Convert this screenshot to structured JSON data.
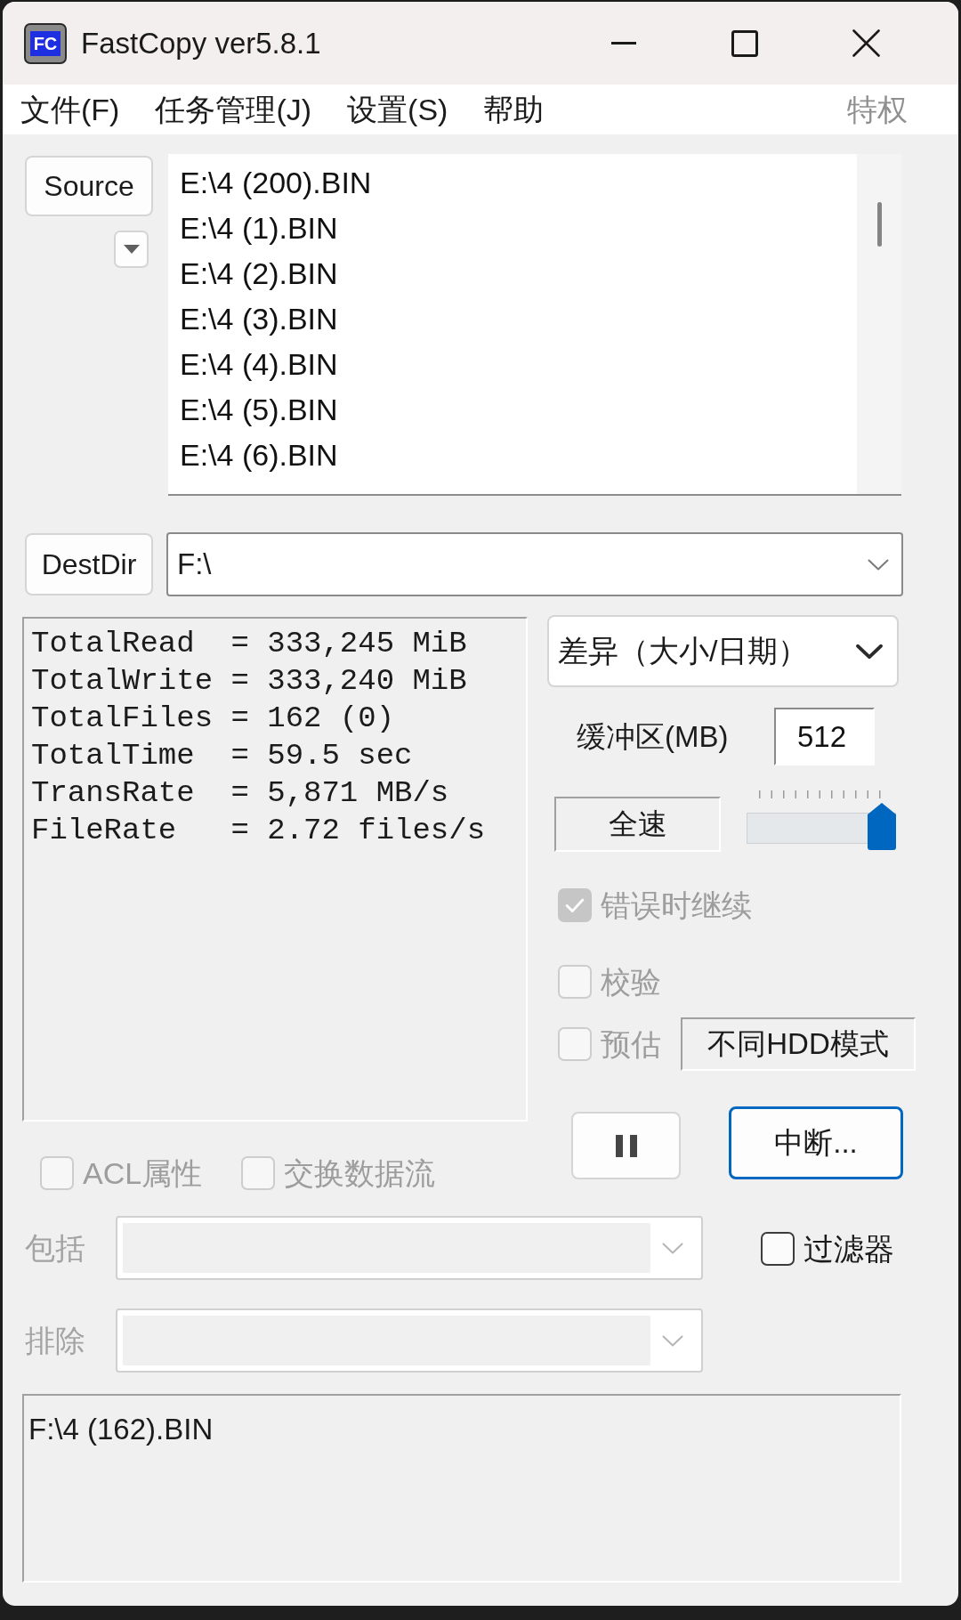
{
  "window": {
    "title": "FastCopy ver5.8.1",
    "icon_text": "FC"
  },
  "menu": {
    "items": [
      {
        "label": "文件(F)",
        "disabled": false
      },
      {
        "label": "任务管理(J)",
        "disabled": false
      },
      {
        "label": "设置(S)",
        "disabled": false
      },
      {
        "label": "帮助",
        "disabled": false
      }
    ],
    "right_item": {
      "label": "特权",
      "disabled": true
    }
  },
  "source": {
    "button": "Source",
    "files": [
      "E:\\4 (200).BIN",
      "E:\\4 (1).BIN",
      "E:\\4 (2).BIN",
      "E:\\4 (3).BIN",
      "E:\\4 (4).BIN",
      "E:\\4 (5).BIN",
      "E:\\4 (6).BIN"
    ]
  },
  "dest": {
    "button": "DestDir",
    "value": "F:\\"
  },
  "stats": [
    "TotalRead  = 333,245 MiB",
    "TotalWrite = 333,240 MiB",
    "TotalFiles = 162 (0)",
    "TotalTime  = 59.5 sec",
    "TransRate  = 5,871 MB/s",
    "FileRate   = 2.72 files/s"
  ],
  "mode": {
    "value": "差异（大小/日期）"
  },
  "buffer": {
    "label": "缓冲区(MB)",
    "value": "512"
  },
  "speed": {
    "readout": "全速",
    "level": 1
  },
  "options": [
    {
      "label": "错误时继续",
      "checked": true,
      "disabled": true
    },
    {
      "label": "校验",
      "checked": false,
      "disabled": true
    },
    {
      "label": "预估",
      "checked": false,
      "disabled": true
    }
  ],
  "hdd_mode": "不同HDD模式",
  "abort": {
    "label": "中断...",
    "focused": true
  },
  "extra_options": [
    {
      "label": "ACL属性",
      "checked": false,
      "disabled": true
    },
    {
      "label": "交换数据流",
      "checked": false,
      "disabled": true
    }
  ],
  "filters": [
    {
      "label": "包括",
      "disabled": true
    },
    {
      "label": "排除",
      "disabled": true
    }
  ],
  "filter_toggle": {
    "label": "过滤器",
    "checked": false,
    "disabled": false
  },
  "status": {
    "text": "F:\\4 (162).BIN"
  }
}
